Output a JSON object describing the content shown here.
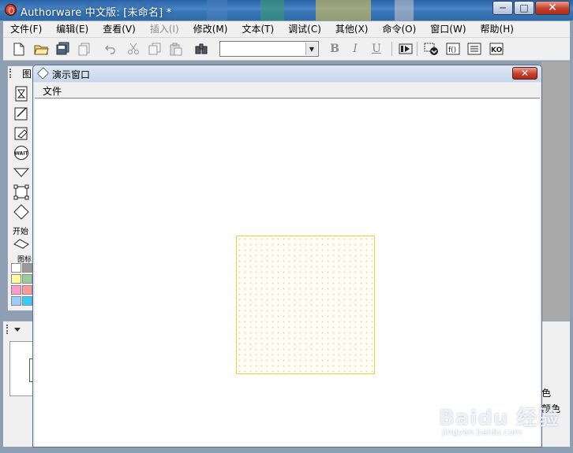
{
  "app": {
    "title": "Authorware 中文版: [未命名] *",
    "caption": {
      "minimize": "─",
      "maximize": "□",
      "close": "✕"
    }
  },
  "menubar": {
    "items": [
      {
        "label": "文件(F)",
        "enabled": true
      },
      {
        "label": "编辑(E)",
        "enabled": true
      },
      {
        "label": "查看(V)",
        "enabled": true
      },
      {
        "label": "插入(I)",
        "enabled": false
      },
      {
        "label": "修改(M)",
        "enabled": true
      },
      {
        "label": "文本(T)",
        "enabled": true
      },
      {
        "label": "调试(C)",
        "enabled": true
      },
      {
        "label": "其他(X)",
        "enabled": true
      },
      {
        "label": "命令(O)",
        "enabled": true
      },
      {
        "label": "窗口(W)",
        "enabled": true
      },
      {
        "label": "帮助(H)",
        "enabled": true
      }
    ]
  },
  "toolbar": {
    "font_select_value": "",
    "bold": "B",
    "italic": "I",
    "underline": "U",
    "icons": [
      "new-file-icon",
      "open-folder-icon",
      "save-all-icon",
      "import-icon",
      "undo-icon",
      "cut-icon",
      "copy-icon",
      "paste-icon",
      "find-icon",
      "run-icon",
      "control-panel-icon",
      "functions-icon",
      "variables-icon",
      "knowledge-objects-icon"
    ]
  },
  "palette": {
    "title": "图",
    "start_label": "开始",
    "icon_label": "图标",
    "tools": [
      "display-icon",
      "animation-icon",
      "erase-icon",
      "wait-icon",
      "navigate-icon",
      "framework-icon",
      "decision-icon",
      "interaction-icon"
    ],
    "wait_text": "WAIT",
    "swatch_colors": [
      "#ffffff",
      "#9a9a9a",
      "#ffff99",
      "#99cc99",
      "#ff99cc",
      "#ff9999",
      "#99ccff",
      "#33ccff"
    ]
  },
  "presentation_window": {
    "title": "演示窗口",
    "menu_file": "文件",
    "close": "✕",
    "rect_border_color": "#f5cf3a"
  },
  "side_panel": {
    "text1": "色",
    "text2": "颜色"
  },
  "watermark": {
    "logo": "Baidu 经验",
    "url": "jingyan.baidu.com"
  }
}
